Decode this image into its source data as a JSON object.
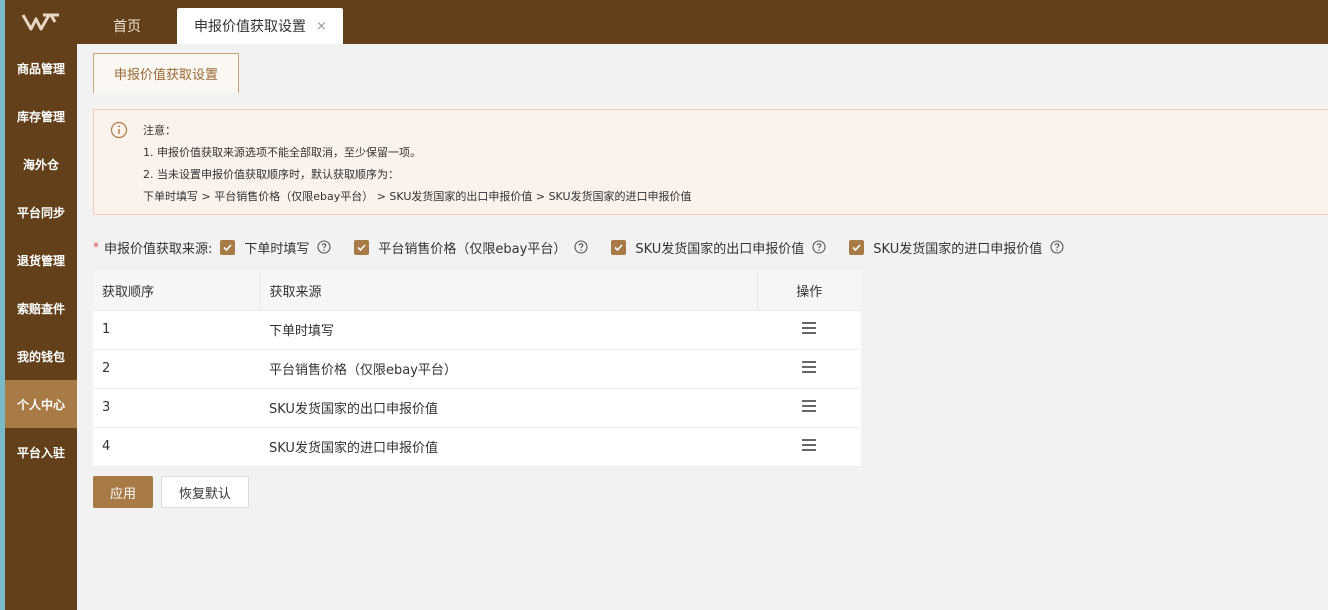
{
  "colors": {
    "brand_dark": "#633f1a",
    "brand_accent": "#a87a45",
    "required": "#e84b3c"
  },
  "sidebar": {
    "logo_icon": "w-logo-icon",
    "items": [
      {
        "label": "商品管理"
      },
      {
        "label": "库存管理"
      },
      {
        "label": "海外仓"
      },
      {
        "label": "平台同步"
      },
      {
        "label": "退货管理"
      },
      {
        "label": "索赔查件"
      },
      {
        "label": "我的钱包"
      },
      {
        "label": "个人中心",
        "active": true
      },
      {
        "label": "平台入驻"
      }
    ]
  },
  "tabs": {
    "home": "首页",
    "current": "申报价值获取设置",
    "close": "×"
  },
  "subtab": {
    "label": "申报价值获取设置"
  },
  "notice": {
    "title": "注意：",
    "line1": "1. 申报价值获取来源选项不能全部取消，至少保留一项。",
    "line2": "2. 当未设置申报价值获取顺序时，默认获取顺序为：",
    "line3": "下单时填写 > 平台销售价格（仅限ebay平台） > SKU发货国家的出口申报价值 >  SKU发货国家的进口申报价值"
  },
  "source": {
    "required_mark": "*",
    "label": "申报价值获取来源:",
    "options": [
      {
        "label": "下单时填写",
        "checked": true
      },
      {
        "label": "平台销售价格（仅限ebay平台）",
        "checked": true
      },
      {
        "label": "SKU发货国家的出口申报价值",
        "checked": true
      },
      {
        "label": "SKU发货国家的进口申报价值",
        "checked": true
      }
    ]
  },
  "table": {
    "headers": {
      "order": "获取顺序",
      "source": "获取来源",
      "action": "操作"
    },
    "rows": [
      {
        "order": "1",
        "source": "下单时填写"
      },
      {
        "order": "2",
        "source": "平台销售价格（仅限ebay平台）"
      },
      {
        "order": "3",
        "source": "SKU发货国家的出口申报价值"
      },
      {
        "order": "4",
        "source": "SKU发货国家的进口申报价值"
      }
    ]
  },
  "buttons": {
    "apply": "应用",
    "reset": "恢复默认"
  }
}
